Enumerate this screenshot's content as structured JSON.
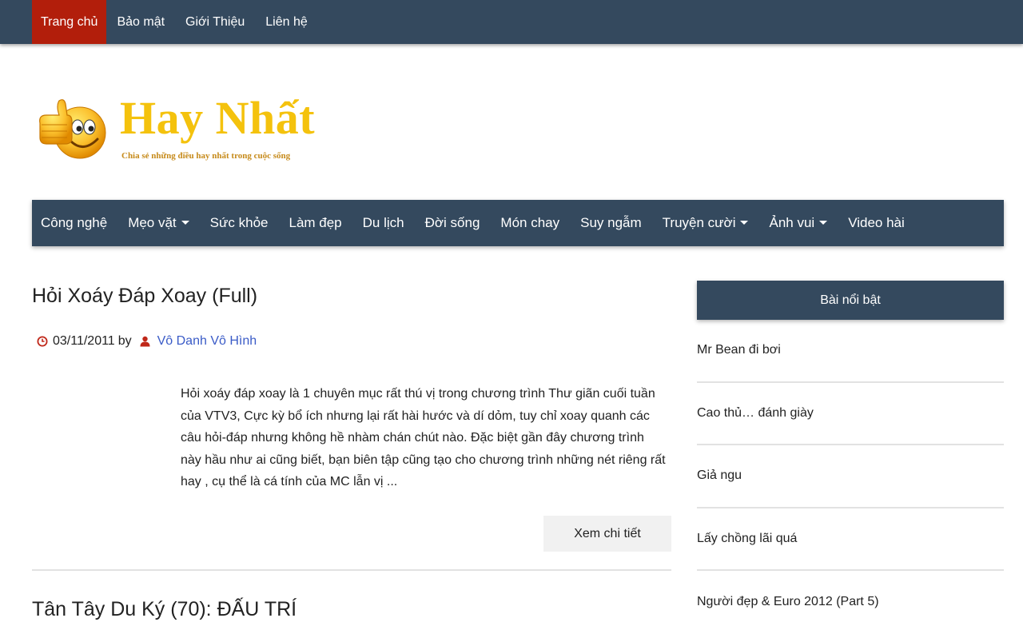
{
  "topnav": {
    "items": [
      {
        "label": "Trang chủ",
        "active": true
      },
      {
        "label": "Bảo mật"
      },
      {
        "label": "Giới Thiệu"
      },
      {
        "label": "Liên hệ"
      }
    ]
  },
  "logo": {
    "brand": "Hay Nhất",
    "tagline": "Chia sẻ những điều hay nhất trong cuộc sống"
  },
  "mainnav": {
    "items": [
      {
        "label": "Công nghệ",
        "dropdown": false
      },
      {
        "label": "Mẹo vặt",
        "dropdown": true
      },
      {
        "label": "Sức khỏe",
        "dropdown": false
      },
      {
        "label": "Làm đẹp",
        "dropdown": false
      },
      {
        "label": "Du lịch",
        "dropdown": false
      },
      {
        "label": "Đời sống",
        "dropdown": false
      },
      {
        "label": "Món chay",
        "dropdown": false
      },
      {
        "label": "Suy ngẫm",
        "dropdown": false
      },
      {
        "label": "Truyện cười",
        "dropdown": true
      },
      {
        "label": "Ảnh vui",
        "dropdown": true
      },
      {
        "label": "Video hài",
        "dropdown": false
      }
    ]
  },
  "post": {
    "title": "Hỏi Xoáy Đáp Xoay (Full)",
    "date": "03/11/2011",
    "by": "by",
    "author": "Vô Danh Vô Hình",
    "excerpt": "Hỏi xoáy đáp xoay là 1 chuyên mục rất thú vị trong chương trình Thư giãn cuối tuần của VTV3, Cực kỳ bổ ích nhưng lại rất hài hước và dí dỏm, tuy chỉ xoay quanh các câu hỏi-đáp nhưng không hề nhàm chán chút nào. Đặc biệt gần đây chương trình này hầu như ai cũng biết, bạn biên tập cũng tạo cho chương trình những nét riêng rất hay , cụ thể là cá tính của MC lẫn vị ...",
    "readmore": "Xem chi tiết"
  },
  "post2": {
    "title": "Tân Tây Du Ký (70): ĐẤU TRÍ"
  },
  "sidebar": {
    "title": "Bài nổi bật",
    "items": [
      "Mr Bean đi bơi",
      "Cao thủ… đánh giày",
      "Giả ngu",
      "Lấy chồng lãi quá",
      "Người đẹp & Euro 2012 (Part 5)"
    ]
  },
  "colors": {
    "nav_bg": "#34495e",
    "active_bg": "#b21e0b",
    "brand_yellow": "#f4c20d",
    "author_link": "#3a5bc7",
    "meta_icon": "#c0281a"
  }
}
